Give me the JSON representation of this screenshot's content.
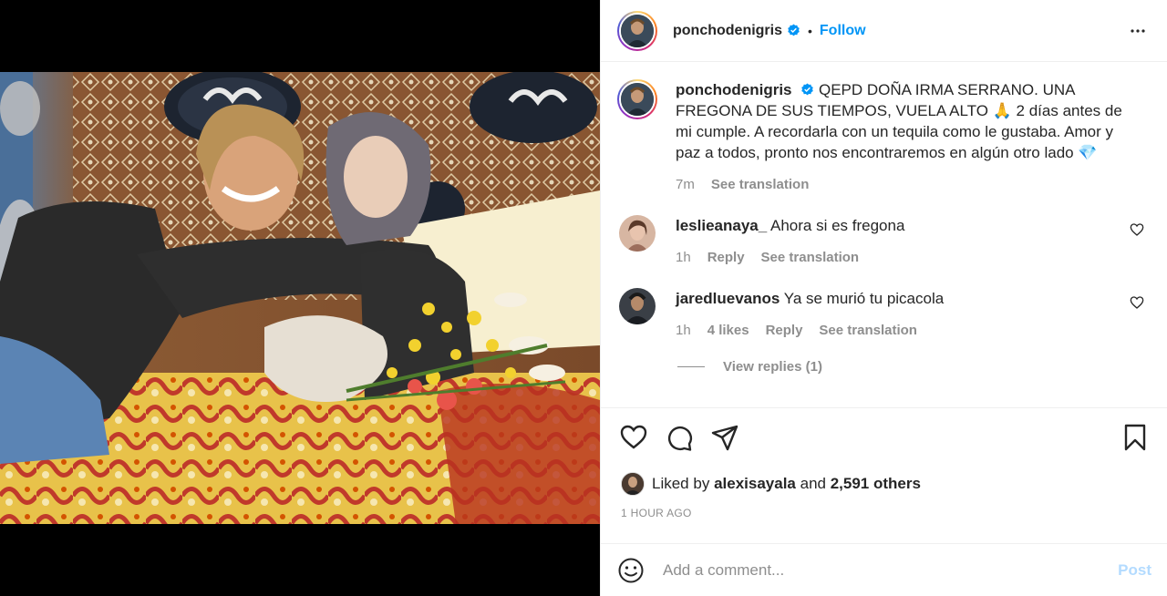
{
  "header": {
    "username": "ponchodenigris",
    "separator": "•",
    "follow_label": "Follow",
    "more_icon": "more-horizontal-icon"
  },
  "caption": {
    "username": "ponchodenigris",
    "text": "QEPD DOÑA IRMA SERRANO. UNA FREGONA DE SUS TIEMPOS, VUELA ALTO 🙏 2 días antes de mi cumple. A recordarla con un tequila como le gustaba. Amor y paz a todos, pronto nos encontraremos en algún otro lado 💎",
    "time": "7m",
    "see_translation": "See translation"
  },
  "comments": [
    {
      "username": "leslieanaya_",
      "text": "Ahora si es fregona",
      "time": "1h",
      "likes": "",
      "reply": "Reply",
      "see_translation": "See translation"
    },
    {
      "username": "jaredluevanos",
      "text": "Ya se murió tu picacola",
      "time": "1h",
      "likes": "4 likes",
      "reply": "Reply",
      "see_translation": "See translation",
      "view_replies": "View replies (1)"
    }
  ],
  "actions": {
    "like_icon": "heart-icon",
    "comment_icon": "comment-icon",
    "share_icon": "share-icon",
    "save_icon": "bookmark-icon"
  },
  "likes": {
    "prefix": "Liked by",
    "user": "alexisayala",
    "conj": "and",
    "others": "2,591 others"
  },
  "timestamp": "1 HOUR AGO",
  "add_comment": {
    "placeholder": "Add a comment...",
    "post_label": "Post"
  },
  "colors": {
    "accent": "#0095f6",
    "post_disabled": "#b3dbff",
    "muted": "#8e8e8e",
    "text": "#262626"
  }
}
